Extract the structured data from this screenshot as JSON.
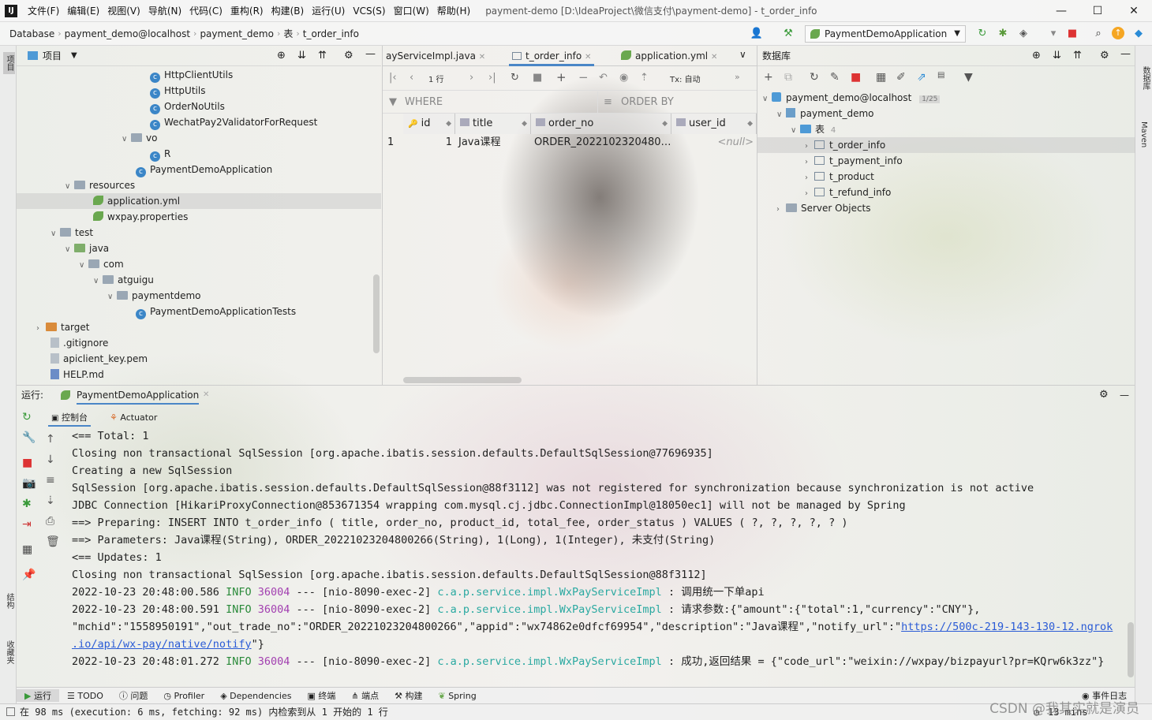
{
  "titlebar": {
    "menus": [
      "文件(F)",
      "编辑(E)",
      "视图(V)",
      "导航(N)",
      "代码(C)",
      "重构(R)",
      "构建(B)",
      "运行(U)",
      "VCS(S)",
      "窗口(W)",
      "帮助(H)"
    ],
    "window_title": "payment-demo [D:\\IdeaProject\\微信支付\\payment-demo] - t_order_info",
    "minimize": "—",
    "maximize": "☐",
    "close": "✕"
  },
  "navbar": {
    "breadcrumbs": [
      "Database",
      "payment_demo@localhost",
      "payment_demo",
      "表",
      "t_order_info"
    ],
    "run_config": "PaymentDemoApplication"
  },
  "project": {
    "header_label": "项目",
    "tree": [
      {
        "label": "HttpClientUtils",
        "icon": "class"
      },
      {
        "label": "HttpUtils",
        "icon": "class"
      },
      {
        "label": "OrderNoUtils",
        "icon": "class"
      },
      {
        "label": "WechatPay2ValidatorForRequest",
        "icon": "class"
      },
      {
        "label": "vo",
        "icon": "folder"
      },
      {
        "label": "R",
        "icon": "class"
      },
      {
        "label": "PaymentDemoApplication",
        "icon": "class"
      },
      {
        "label": "resources",
        "icon": "folder"
      },
      {
        "label": "application.yml",
        "icon": "leaf"
      },
      {
        "label": "wxpay.properties",
        "icon": "leaf"
      },
      {
        "label": "test",
        "icon": "folder"
      },
      {
        "label": "java",
        "icon": "folder-green"
      },
      {
        "label": "com",
        "icon": "folder"
      },
      {
        "label": "atguigu",
        "icon": "folder"
      },
      {
        "label": "paymentdemo",
        "icon": "folder"
      },
      {
        "label": "PaymentDemoApplicationTests",
        "icon": "class"
      },
      {
        "label": "target",
        "icon": "folder-orange"
      },
      {
        "label": ".gitignore",
        "icon": "file"
      },
      {
        "label": "apiclient_key.pem",
        "icon": "file"
      },
      {
        "label": "HELP.md",
        "icon": "file"
      }
    ]
  },
  "editor": {
    "tabs": [
      "ayServiceImpl.java",
      "t_order_info",
      "application.yml"
    ],
    "pager": "1 行",
    "tx_label": "Tx: 自动",
    "where_label": "WHERE",
    "orderby_label": "ORDER BY",
    "columns": [
      "id",
      "title",
      "order_no",
      "user_id"
    ],
    "rows": [
      {
        "num": "1",
        "id": "1",
        "title": "Java课程",
        "order_no": "ORDER_2022102320480…",
        "user_id": "<null>"
      }
    ]
  },
  "database": {
    "header_label": "数据库",
    "tree": [
      {
        "label": "payment_demo@localhost",
        "badge": "1/25"
      },
      {
        "label": "payment_demo"
      },
      {
        "label": "表",
        "badge": "4"
      },
      {
        "label": "t_order_info"
      },
      {
        "label": "t_payment_info"
      },
      {
        "label": "t_product"
      },
      {
        "label": "t_refund_info"
      },
      {
        "label": "Server Objects"
      }
    ]
  },
  "run": {
    "label": "运行:",
    "config_tab": "PaymentDemoApplication",
    "console_tab": "控制台",
    "actuator_tab": "Actuator",
    "lines": [
      "<==      Total: 1",
      "Closing non transactional SqlSession [org.apache.ibatis.session.defaults.DefaultSqlSession@77696935]",
      "Creating a new SqlSession",
      "SqlSession [org.apache.ibatis.session.defaults.DefaultSqlSession@88f3112] was not registered for synchronization because synchronization is not active",
      "JDBC Connection [HikariProxyConnection@853671354 wrapping com.mysql.cj.jdbc.ConnectionImpl@18050ec1] will not be managed by Spring",
      "==>  Preparing: INSERT INTO t_order_info ( title, order_no, product_id, total_fee, order_status ) VALUES ( ?, ?, ?, ?, ? )",
      "==> Parameters: Java课程(String), ORDER_20221023204800266(String), 1(Long), 1(Integer), 未支付(String)",
      "<==    Updates: 1",
      "Closing non transactional SqlSession [org.apache.ibatis.session.defaults.DefaultSqlSession@88f3112]"
    ],
    "log1": {
      "ts": "2022-10-23 20:48:00.586",
      "level": "INFO",
      "pid": "36004",
      "thread": "--- [nio-8090-exec-2]",
      "logger": "c.a.p.service.impl.WxPayServiceImpl",
      "msg": ": 调用统一下单api"
    },
    "log2": {
      "ts": "2022-10-23 20:48:00.591",
      "level": "INFO",
      "pid": "36004",
      "thread": "--- [nio-8090-exec-2]",
      "logger": "c.a.p.service.impl.WxPayServiceImpl",
      "msg": ": 请求参数:{\"amount\":{\"total\":1,\"currency\":\"CNY\"},"
    },
    "log2_cont": " \"mchid\":\"1558950191\",\"out_trade_no\":\"ORDER_20221023204800266\",\"appid\":\"wx74862e0dfcf69954\",\"description\":\"Java课程\",\"notify_url\":\"",
    "log2_link1": "https://500c-219-143-130-12.ngrok",
    "log2_link2": ".io/api/wx-pay/native/notify",
    "log2_end": "\"}",
    "log3": {
      "ts": "2022-10-23 20:48:01.272",
      "level": "INFO",
      "pid": "36004",
      "thread": "--- [nio-8090-exec-2]",
      "logger": "c.a.p.service.impl.WxPayServiceImpl",
      "msg": ": 成功,返回结果 = {\"code_url\":\"weixin://wxpay/bizpayurl?pr=KQrw6k3zz\"}"
    }
  },
  "bottom_tools": [
    "运行",
    "TODO",
    "问题",
    "Profiler",
    "Dependencies",
    "终端",
    "端点",
    "构建",
    "Spring",
    "事件日志"
  ],
  "status": {
    "text": "在 98 ms (execution: 6 ms, fetching: 92 ms) 内检索到从 1 开始的 1 行",
    "mins": "13 mins"
  },
  "side_labels": {
    "left_top": "项目",
    "left_mid": "结构",
    "left_bottom": "收藏夹",
    "right_top": "数据库",
    "right_mid": "Maven"
  },
  "watermark": "CSDN @我其实就是演员"
}
